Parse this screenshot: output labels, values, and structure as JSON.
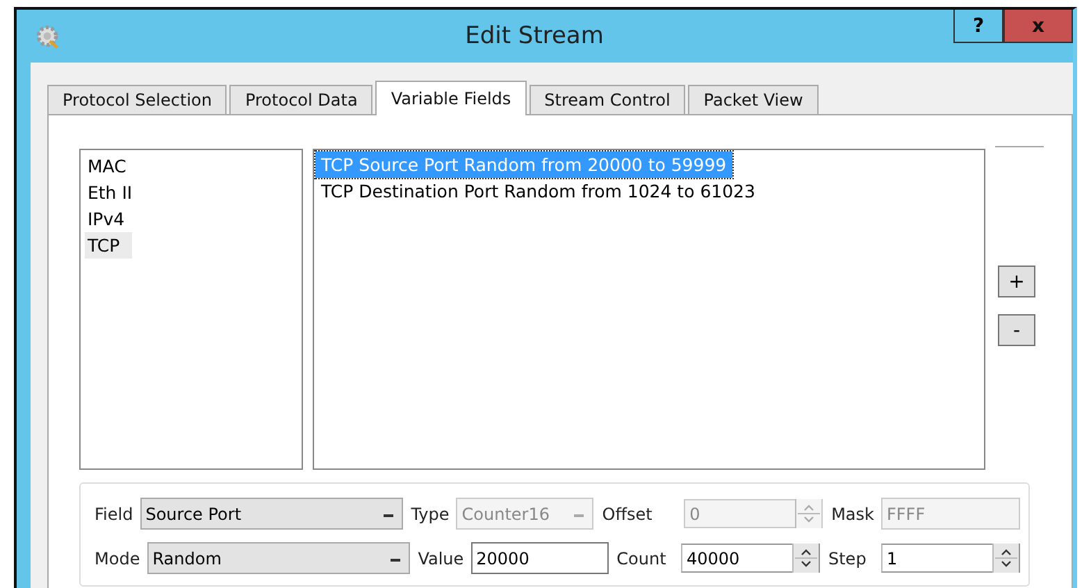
{
  "window": {
    "title": "Edit Stream",
    "help_button": "?",
    "close_button": "x"
  },
  "tabs": [
    {
      "label": "Protocol Selection",
      "selected": false
    },
    {
      "label": "Protocol Data",
      "selected": false
    },
    {
      "label": "Variable Fields",
      "selected": true
    },
    {
      "label": "Stream Control",
      "selected": false
    },
    {
      "label": "Packet View",
      "selected": false
    }
  ],
  "protocols": [
    {
      "label": "MAC",
      "selected": false
    },
    {
      "label": "Eth II",
      "selected": false
    },
    {
      "label": "IPv4",
      "selected": false
    },
    {
      "label": "TCP",
      "selected": true
    }
  ],
  "variable_fields": [
    {
      "label": "TCP Source Port Random from 20000 to 59999",
      "selected": true
    },
    {
      "label": "TCP Destination Port Random from 1024 to 61023",
      "selected": false
    }
  ],
  "list_buttons": [
    "+",
    "-"
  ],
  "form": [
    [
      {
        "label": "Field",
        "kind": "combo",
        "value": "Source Port",
        "disabled": false
      },
      {
        "label": "Type",
        "kind": "combo",
        "value": "Counter16",
        "disabled": true
      },
      {
        "label": "Offset",
        "kind": "spin",
        "value": "0",
        "disabled": true
      },
      {
        "label": "Mask",
        "kind": "input",
        "value": "FFFF",
        "disabled": true
      }
    ],
    [
      {
        "label": "Mode",
        "kind": "combo",
        "value": "Random",
        "disabled": false
      },
      {
        "label": "Value",
        "kind": "input",
        "value": "20000",
        "disabled": false
      },
      {
        "label": "Count",
        "kind": "spin",
        "value": "40000",
        "disabled": false
      },
      {
        "label": "Step",
        "kind": "spin",
        "value": "1",
        "disabled": false
      }
    ]
  ]
}
